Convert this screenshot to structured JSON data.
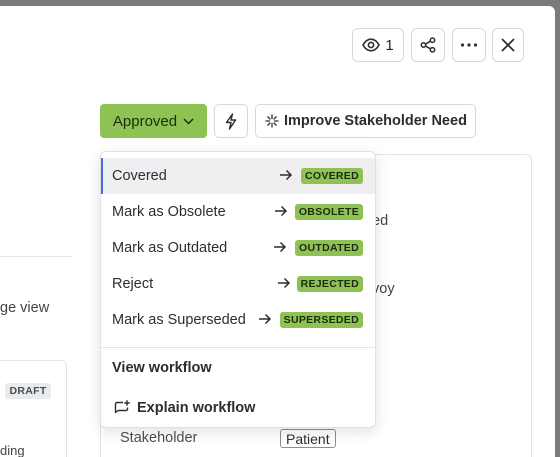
{
  "header": {
    "watchers_count": "1",
    "icons": [
      "eye-icon",
      "share-icon",
      "more-icon",
      "close-icon"
    ]
  },
  "toolbar": {
    "status_label": "Approved",
    "status_color": "#8ec354",
    "improve_label": "Improve Stakeholder Need"
  },
  "background": {
    "view_fragment": "ge view",
    "ed_fragment": "ed",
    "voy_fragment": "voy",
    "draft_badge": "DRAFT",
    "ding_fragment": "ding",
    "stakeholder_label": "Stakeholder",
    "stakeholder_value": "Patient"
  },
  "menu": {
    "transitions": [
      {
        "label": "Covered",
        "badge": "COVERED"
      },
      {
        "label": "Mark as Obsolete",
        "badge": "OBSOLETE"
      },
      {
        "label": "Mark as Outdated",
        "badge": "OUTDATED"
      },
      {
        "label": "Reject",
        "badge": "REJECTED"
      },
      {
        "label": "Mark as Superseded",
        "badge": "SUPERSEDED"
      }
    ],
    "view_workflow": "View workflow",
    "explain_workflow": "Explain workflow",
    "accent_color": "#4b6fd8"
  }
}
